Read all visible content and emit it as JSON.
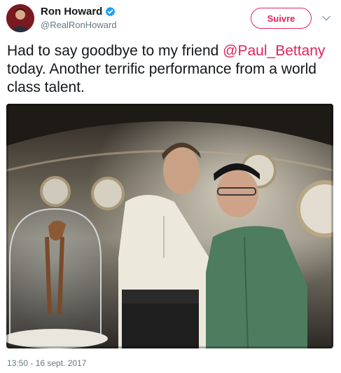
{
  "author": {
    "name": "Ron Howard",
    "handle": "@RealRonHoward",
    "verified_icon": "verified-badge-icon"
  },
  "follow_button": {
    "label": "Suivre"
  },
  "menu": {
    "icon": "chevron-down-icon"
  },
  "tweet": {
    "text_before": "Had to say goodbye to my friend ",
    "mention": "@Paul_Bettany",
    "text_after": " today. Another terrific performance from a world class talent."
  },
  "timestamp": "13:50 - 16 sept. 2017",
  "colors": {
    "accent": "#e0245e",
    "verified": "#1da1f2",
    "secondary_text": "#657786",
    "primary_text": "#14171a"
  }
}
